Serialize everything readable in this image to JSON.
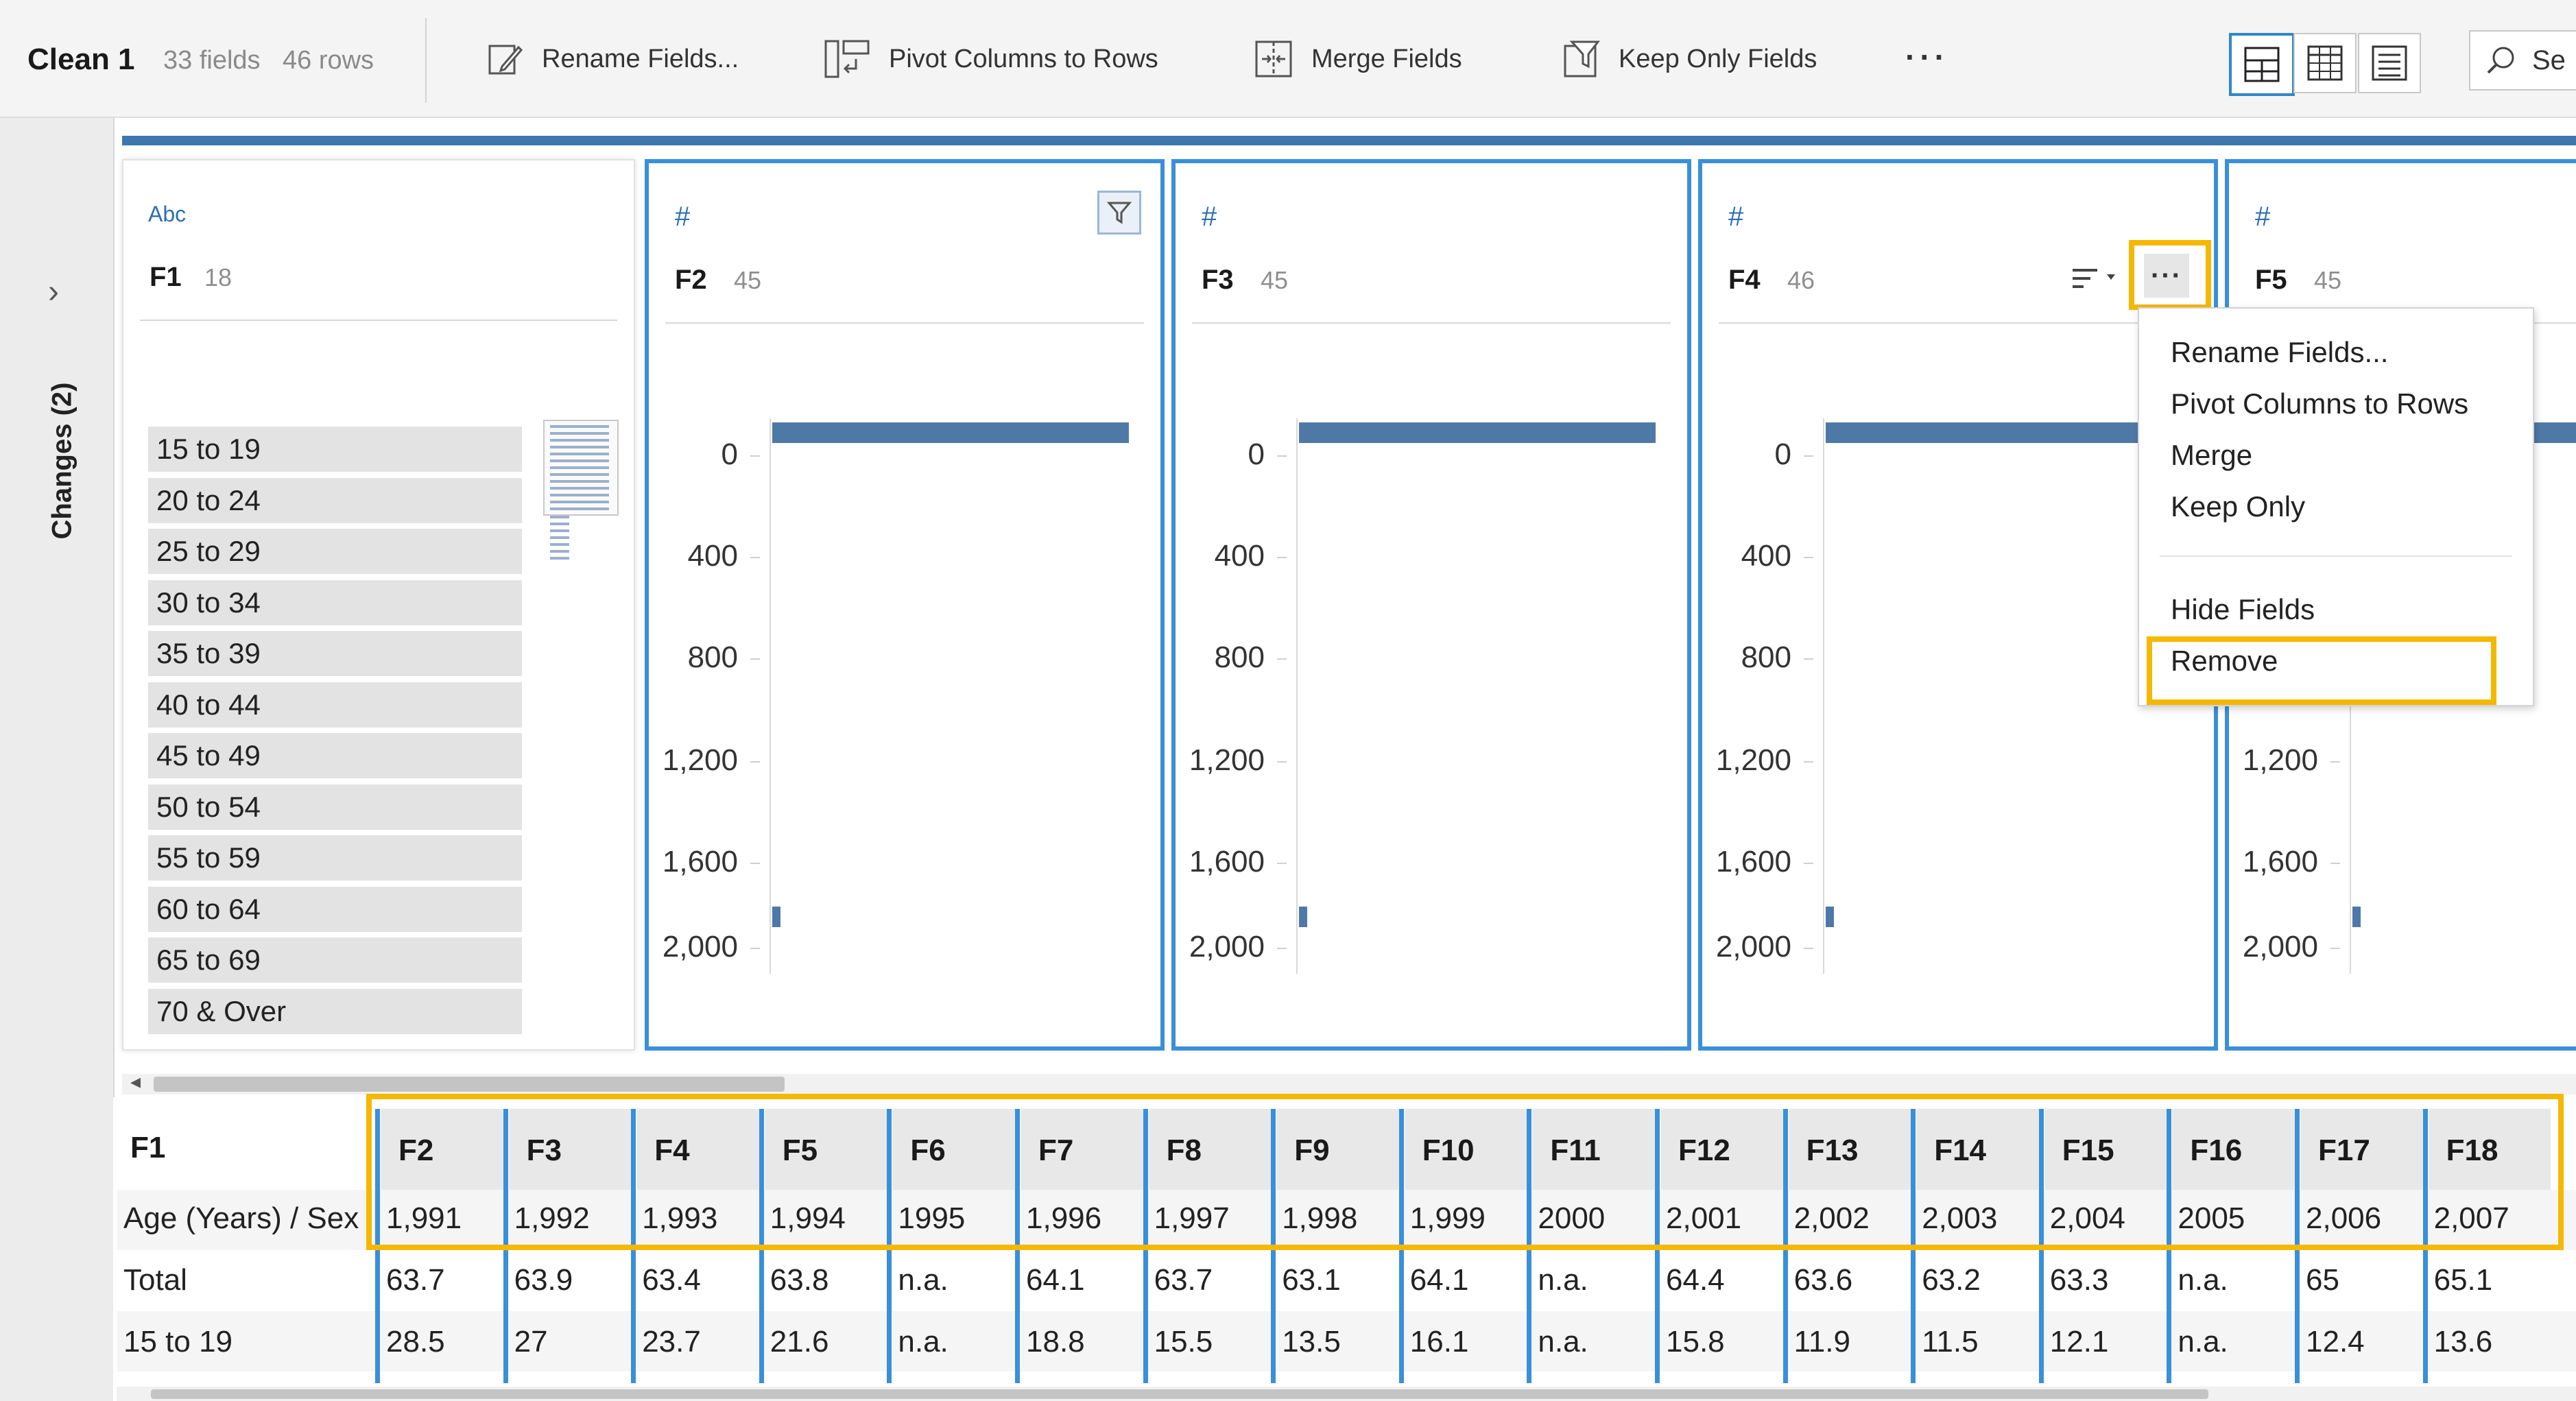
{
  "toolbar": {
    "title": "Clean 1",
    "fields_count": "33 fields",
    "rows_count": "46 rows",
    "rename_label": "Rename Fields...",
    "pivot_label": "Pivot Columns to Rows",
    "merge_label": "Merge Fields",
    "keep_label": "Keep Only Fields",
    "more_label": "···",
    "search_label": "Se"
  },
  "rail": {
    "label": "Changes (2)",
    "expand_icon": "chevron-right-icon"
  },
  "profile": {
    "F1": {
      "type": "Abc",
      "name": "F1",
      "count": "18",
      "bins": [
        "15 to 19",
        "20 to 24",
        "25 to 29",
        "30 to 34",
        "35 to 39",
        "40 to 44",
        "45 to 49",
        "50 to 54",
        "55 to 59",
        "60 to 64",
        "65 to 69",
        "70 & Over"
      ]
    },
    "F2": {
      "type": "#",
      "name": "F2",
      "count": "45"
    },
    "F3": {
      "type": "#",
      "name": "F3",
      "count": "45"
    },
    "F4": {
      "type": "#",
      "name": "F4",
      "count": "46"
    },
    "F5": {
      "type": "#",
      "name": "F5",
      "count": "45"
    },
    "axis_labels": [
      "0",
      "400",
      "800",
      "1,200",
      "1,600",
      "2,000"
    ]
  },
  "menu": {
    "items": [
      "Rename Fields...",
      "Pivot Columns to Rows",
      "Merge",
      "Keep Only",
      "Hide Fields",
      "Remove"
    ]
  },
  "grid": {
    "first_header": "F1",
    "headers": [
      "F2",
      "F3",
      "F4",
      "F5",
      "F6",
      "F7",
      "F8",
      "F9",
      "F10",
      "F11",
      "F12",
      "F13",
      "F14",
      "F15",
      "F16",
      "F17",
      "F18"
    ],
    "rows": [
      {
        "label": "Age (Years) / Sex",
        "values": [
          "1,991",
          "1,992",
          "1,993",
          "1,994",
          "1995",
          "1,996",
          "1,997",
          "1,998",
          "1,999",
          "2000",
          "2,001",
          "2,002",
          "2,003",
          "2,004",
          "2005",
          "2,006",
          "2,007"
        ]
      },
      {
        "label": "Total",
        "values": [
          "63.7",
          "63.9",
          "63.4",
          "63.8",
          "n.a.",
          "64.1",
          "63.7",
          "63.1",
          "64.1",
          "n.a.",
          "64.4",
          "63.6",
          "63.2",
          "63.3",
          "n.a.",
          "65",
          "65.1"
        ]
      },
      {
        "label": "15 to 19",
        "values": [
          "28.5",
          "27",
          "23.7",
          "21.6",
          "n.a.",
          "18.8",
          "15.5",
          "13.5",
          "16.1",
          "n.a.",
          "15.8",
          "11.9",
          "11.5",
          "12.1",
          "n.a.",
          "12.4",
          "13.6"
        ]
      }
    ]
  },
  "colors": {
    "accent": "#3a8fd9",
    "highlight": "#f5b800",
    "bar": "#4e79a7",
    "band": "#3c78ad"
  }
}
